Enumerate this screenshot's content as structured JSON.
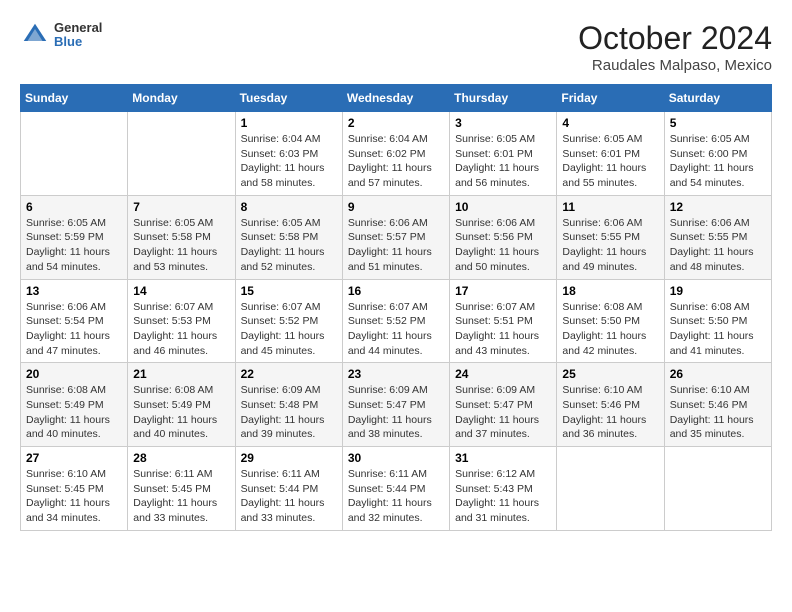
{
  "header": {
    "logo_general": "General",
    "logo_blue": "Blue",
    "month": "October 2024",
    "location": "Raudales Malpaso, Mexico"
  },
  "weekdays": [
    "Sunday",
    "Monday",
    "Tuesday",
    "Wednesday",
    "Thursday",
    "Friday",
    "Saturday"
  ],
  "weeks": [
    [
      {
        "day": "",
        "sunrise": "",
        "sunset": "",
        "daylight": ""
      },
      {
        "day": "",
        "sunrise": "",
        "sunset": "",
        "daylight": ""
      },
      {
        "day": "1",
        "sunrise": "Sunrise: 6:04 AM",
        "sunset": "Sunset: 6:03 PM",
        "daylight": "Daylight: 11 hours and 58 minutes."
      },
      {
        "day": "2",
        "sunrise": "Sunrise: 6:04 AM",
        "sunset": "Sunset: 6:02 PM",
        "daylight": "Daylight: 11 hours and 57 minutes."
      },
      {
        "day": "3",
        "sunrise": "Sunrise: 6:05 AM",
        "sunset": "Sunset: 6:01 PM",
        "daylight": "Daylight: 11 hours and 56 minutes."
      },
      {
        "day": "4",
        "sunrise": "Sunrise: 6:05 AM",
        "sunset": "Sunset: 6:01 PM",
        "daylight": "Daylight: 11 hours and 55 minutes."
      },
      {
        "day": "5",
        "sunrise": "Sunrise: 6:05 AM",
        "sunset": "Sunset: 6:00 PM",
        "daylight": "Daylight: 11 hours and 54 minutes."
      }
    ],
    [
      {
        "day": "6",
        "sunrise": "Sunrise: 6:05 AM",
        "sunset": "Sunset: 5:59 PM",
        "daylight": "Daylight: 11 hours and 54 minutes."
      },
      {
        "day": "7",
        "sunrise": "Sunrise: 6:05 AM",
        "sunset": "Sunset: 5:58 PM",
        "daylight": "Daylight: 11 hours and 53 minutes."
      },
      {
        "day": "8",
        "sunrise": "Sunrise: 6:05 AM",
        "sunset": "Sunset: 5:58 PM",
        "daylight": "Daylight: 11 hours and 52 minutes."
      },
      {
        "day": "9",
        "sunrise": "Sunrise: 6:06 AM",
        "sunset": "Sunset: 5:57 PM",
        "daylight": "Daylight: 11 hours and 51 minutes."
      },
      {
        "day": "10",
        "sunrise": "Sunrise: 6:06 AM",
        "sunset": "Sunset: 5:56 PM",
        "daylight": "Daylight: 11 hours and 50 minutes."
      },
      {
        "day": "11",
        "sunrise": "Sunrise: 6:06 AM",
        "sunset": "Sunset: 5:55 PM",
        "daylight": "Daylight: 11 hours and 49 minutes."
      },
      {
        "day": "12",
        "sunrise": "Sunrise: 6:06 AM",
        "sunset": "Sunset: 5:55 PM",
        "daylight": "Daylight: 11 hours and 48 minutes."
      }
    ],
    [
      {
        "day": "13",
        "sunrise": "Sunrise: 6:06 AM",
        "sunset": "Sunset: 5:54 PM",
        "daylight": "Daylight: 11 hours and 47 minutes."
      },
      {
        "day": "14",
        "sunrise": "Sunrise: 6:07 AM",
        "sunset": "Sunset: 5:53 PM",
        "daylight": "Daylight: 11 hours and 46 minutes."
      },
      {
        "day": "15",
        "sunrise": "Sunrise: 6:07 AM",
        "sunset": "Sunset: 5:52 PM",
        "daylight": "Daylight: 11 hours and 45 minutes."
      },
      {
        "day": "16",
        "sunrise": "Sunrise: 6:07 AM",
        "sunset": "Sunset: 5:52 PM",
        "daylight": "Daylight: 11 hours and 44 minutes."
      },
      {
        "day": "17",
        "sunrise": "Sunrise: 6:07 AM",
        "sunset": "Sunset: 5:51 PM",
        "daylight": "Daylight: 11 hours and 43 minutes."
      },
      {
        "day": "18",
        "sunrise": "Sunrise: 6:08 AM",
        "sunset": "Sunset: 5:50 PM",
        "daylight": "Daylight: 11 hours and 42 minutes."
      },
      {
        "day": "19",
        "sunrise": "Sunrise: 6:08 AM",
        "sunset": "Sunset: 5:50 PM",
        "daylight": "Daylight: 11 hours and 41 minutes."
      }
    ],
    [
      {
        "day": "20",
        "sunrise": "Sunrise: 6:08 AM",
        "sunset": "Sunset: 5:49 PM",
        "daylight": "Daylight: 11 hours and 40 minutes."
      },
      {
        "day": "21",
        "sunrise": "Sunrise: 6:08 AM",
        "sunset": "Sunset: 5:49 PM",
        "daylight": "Daylight: 11 hours and 40 minutes."
      },
      {
        "day": "22",
        "sunrise": "Sunrise: 6:09 AM",
        "sunset": "Sunset: 5:48 PM",
        "daylight": "Daylight: 11 hours and 39 minutes."
      },
      {
        "day": "23",
        "sunrise": "Sunrise: 6:09 AM",
        "sunset": "Sunset: 5:47 PM",
        "daylight": "Daylight: 11 hours and 38 minutes."
      },
      {
        "day": "24",
        "sunrise": "Sunrise: 6:09 AM",
        "sunset": "Sunset: 5:47 PM",
        "daylight": "Daylight: 11 hours and 37 minutes."
      },
      {
        "day": "25",
        "sunrise": "Sunrise: 6:10 AM",
        "sunset": "Sunset: 5:46 PM",
        "daylight": "Daylight: 11 hours and 36 minutes."
      },
      {
        "day": "26",
        "sunrise": "Sunrise: 6:10 AM",
        "sunset": "Sunset: 5:46 PM",
        "daylight": "Daylight: 11 hours and 35 minutes."
      }
    ],
    [
      {
        "day": "27",
        "sunrise": "Sunrise: 6:10 AM",
        "sunset": "Sunset: 5:45 PM",
        "daylight": "Daylight: 11 hours and 34 minutes."
      },
      {
        "day": "28",
        "sunrise": "Sunrise: 6:11 AM",
        "sunset": "Sunset: 5:45 PM",
        "daylight": "Daylight: 11 hours and 33 minutes."
      },
      {
        "day": "29",
        "sunrise": "Sunrise: 6:11 AM",
        "sunset": "Sunset: 5:44 PM",
        "daylight": "Daylight: 11 hours and 33 minutes."
      },
      {
        "day": "30",
        "sunrise": "Sunrise: 6:11 AM",
        "sunset": "Sunset: 5:44 PM",
        "daylight": "Daylight: 11 hours and 32 minutes."
      },
      {
        "day": "31",
        "sunrise": "Sunrise: 6:12 AM",
        "sunset": "Sunset: 5:43 PM",
        "daylight": "Daylight: 11 hours and 31 minutes."
      },
      {
        "day": "",
        "sunrise": "",
        "sunset": "",
        "daylight": ""
      },
      {
        "day": "",
        "sunrise": "",
        "sunset": "",
        "daylight": ""
      }
    ]
  ]
}
